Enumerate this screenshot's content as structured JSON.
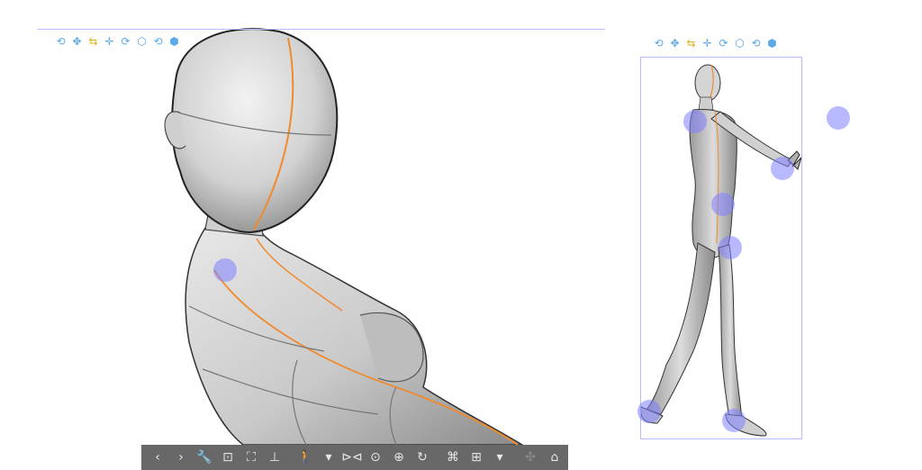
{
  "colors": {
    "guide": "#b9b9ff",
    "handle": "#8080ff",
    "toolbar_bg": "#686868",
    "toolbar_icon": "#e6e6e6",
    "mini_tool_blue": "#5aa9e6",
    "mini_tool_yellow": "#e0b21b",
    "body_line": "#f08a2c"
  },
  "mini_toolbar_left": {
    "tools": [
      {
        "name": "rotate-camera-icon",
        "glyph": "⟲",
        "color": "blue"
      },
      {
        "name": "pan-camera-icon",
        "glyph": "✥",
        "color": "blue"
      },
      {
        "name": "move-along-axis-icon",
        "glyph": "⇆",
        "color": "yellow"
      },
      {
        "name": "move-object-icon",
        "glyph": "✛",
        "color": "blue"
      },
      {
        "name": "rotate-object-icon",
        "glyph": "⟳",
        "color": "blue"
      },
      {
        "name": "rotate-object-alt-icon",
        "glyph": "⬡",
        "color": "blue"
      },
      {
        "name": "rotate-object-3d-icon",
        "glyph": "⟲",
        "color": "blue"
      },
      {
        "name": "move-3d-icon",
        "glyph": "⬢",
        "color": "blue"
      }
    ]
  },
  "mini_toolbar_right": {
    "tools": [
      {
        "name": "rotate-camera-icon",
        "glyph": "⟲",
        "color": "blue"
      },
      {
        "name": "pan-camera-icon",
        "glyph": "✥",
        "color": "blue"
      },
      {
        "name": "move-along-axis-icon",
        "glyph": "⇆",
        "color": "yellow"
      },
      {
        "name": "move-object-icon",
        "glyph": "✛",
        "color": "blue"
      },
      {
        "name": "rotate-object-icon",
        "glyph": "⟳",
        "color": "blue"
      },
      {
        "name": "rotate-object-alt-icon",
        "glyph": "⬡",
        "color": "blue"
      },
      {
        "name": "rotate-object-3d-icon",
        "glyph": "⟲",
        "color": "blue"
      },
      {
        "name": "move-3d-icon",
        "glyph": "⬢",
        "color": "blue"
      }
    ]
  },
  "bottom_toolbar": {
    "buttons": [
      {
        "name": "previous-object-button",
        "glyph": "‹"
      },
      {
        "name": "next-object-button",
        "glyph": "›"
      },
      {
        "name": "object-settings-button",
        "glyph": "🔧"
      },
      {
        "name": "camera-angle-button",
        "glyph": "⊡"
      },
      {
        "name": "fit-to-view-button",
        "glyph": "⛶"
      },
      {
        "name": "land-on-floor-button",
        "glyph": "⊥"
      },
      {
        "name": "sep"
      },
      {
        "name": "pose-figure-button",
        "glyph": "🚶"
      },
      {
        "name": "pose-dropdown-button",
        "glyph": "▾"
      },
      {
        "name": "flip-horizontal-button",
        "glyph": "⊳⊲"
      },
      {
        "name": "reset-pose-button",
        "glyph": "⊙"
      },
      {
        "name": "lock-joint-button",
        "glyph": "⊕"
      },
      {
        "name": "rotate-joint-button",
        "glyph": "↻"
      },
      {
        "name": "sep"
      },
      {
        "name": "register-pose-button",
        "glyph": "⌘"
      },
      {
        "name": "body-shape-button",
        "glyph": "⊞"
      },
      {
        "name": "body-shape-dropdown-button",
        "glyph": "▾"
      },
      {
        "name": "sep"
      },
      {
        "name": "disabled-tool-a-button",
        "glyph": "✣",
        "disabled": true
      },
      {
        "name": "disabled-tool-b-button",
        "glyph": "⤢",
        "disabled": true
      }
    ],
    "side_button": {
      "name": "register-to-material-button",
      "glyph": "⌂"
    }
  }
}
